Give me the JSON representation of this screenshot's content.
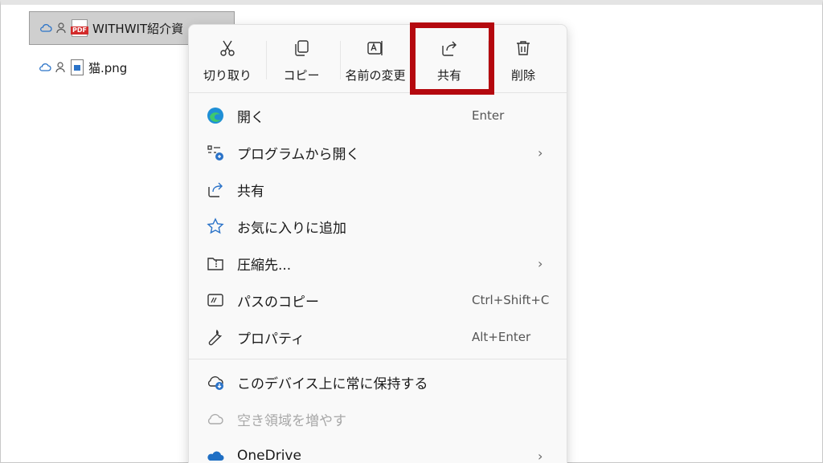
{
  "files": [
    {
      "name": "WITHWIT紹介資",
      "type_badge": "PDF",
      "selected": true
    },
    {
      "name": "猫.png",
      "selected": false
    }
  ],
  "toolbar": {
    "cut": "切り取り",
    "copy": "コピー",
    "rename": "名前の変更",
    "share": "共有",
    "delete": "削除"
  },
  "menu": {
    "open": {
      "label": "開く",
      "shortcut": "Enter"
    },
    "open_with": {
      "label": "プログラムから開く"
    },
    "share": {
      "label": "共有"
    },
    "favorite": {
      "label": "お気に入りに追加"
    },
    "compress": {
      "label": "圧縮先..."
    },
    "copy_path": {
      "label": "パスのコピー",
      "shortcut": "Ctrl+Shift+C"
    },
    "properties": {
      "label": "プロパティ",
      "shortcut": "Alt+Enter"
    },
    "keep_on_device": {
      "label": "このデバイス上に常に保持する"
    },
    "free_space": {
      "label": "空き領域を増やす"
    },
    "onedrive": {
      "label": "OneDrive"
    }
  },
  "colors": {
    "highlight": "#b5090f",
    "accent": "#2b73c8"
  }
}
